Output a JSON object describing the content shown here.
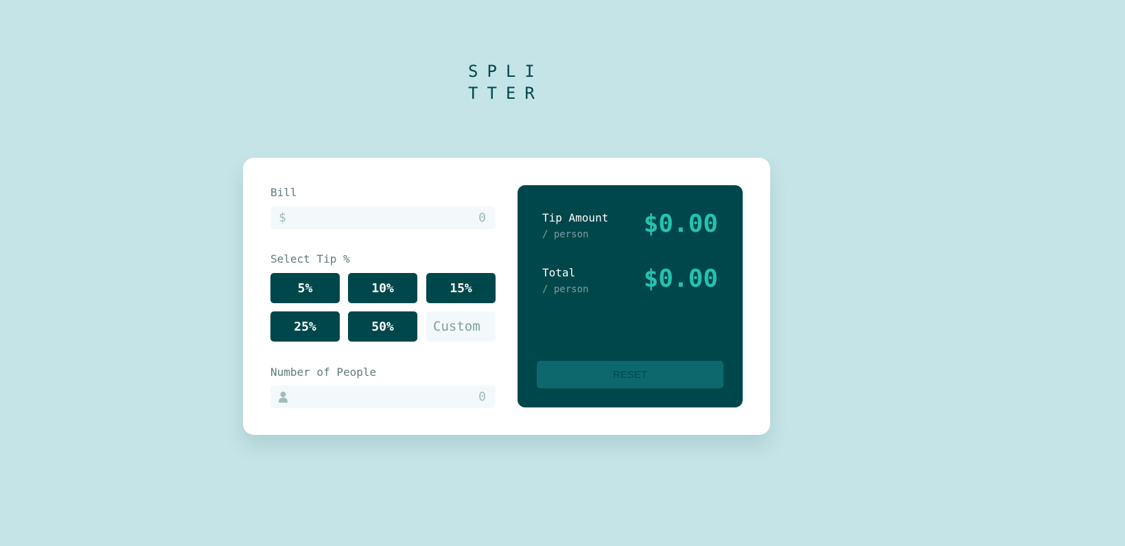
{
  "logo": {
    "line1": "SPLI",
    "line2": "TTER"
  },
  "bill": {
    "label": "Bill",
    "prefix": "$",
    "placeholder": "0",
    "icon": "dollar-icon"
  },
  "tip": {
    "label": "Select Tip %",
    "options": [
      "5%",
      "10%",
      "15%",
      "25%",
      "50%"
    ],
    "custom_placeholder": "Custom"
  },
  "people": {
    "label": "Number of People",
    "placeholder": "0",
    "icon": "person-icon"
  },
  "results": {
    "tip_amount": {
      "title": "Tip Amount",
      "subtitle": "/ person",
      "value": "$0.00"
    },
    "total": {
      "title": "Total",
      "subtitle": "/ person",
      "value": "$0.00"
    },
    "reset_label": "RESET"
  },
  "colors": {
    "background": "#c5e4e7",
    "card": "#ffffff",
    "dark_teal": "#00474b",
    "accent": "#26c2ae",
    "field_bg": "#f3f9fa",
    "label": "#5e7a7d",
    "muted": "#7f9d9f",
    "reset_disabled": "#0d686d"
  }
}
